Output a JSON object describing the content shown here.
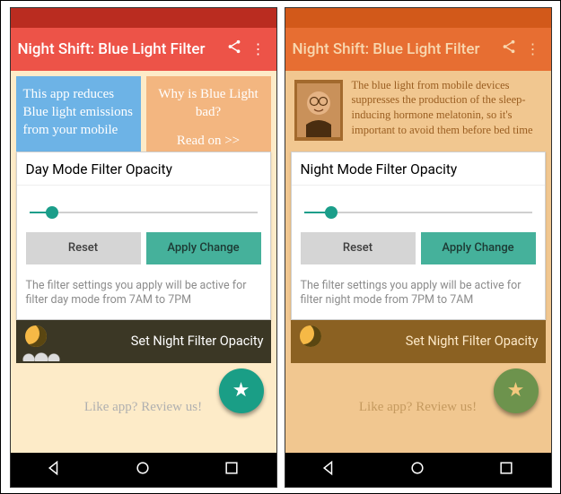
{
  "left": {
    "statusbarColor": "#ba2c20",
    "appbarColor": "#ed5348",
    "title": "Night Shift: Blue Light Filter",
    "cardBlue": "This app reduces Blue light emissions from your mobile",
    "cardOrangeLine1": "Why is Blue Light bad?",
    "cardOrangeLine2": "Read on >>",
    "panelTitle": "Day Mode Filter Opacity",
    "sliderPercent": 10,
    "resetLabel": "Reset",
    "applyLabel": "Apply Change",
    "note": "The filter settings you apply will be active for filter day mode from 7AM to 7PM",
    "nightStripLabel": "Set Night Filter Opacity",
    "reviewLabel": "Like app? Review us!"
  },
  "right": {
    "statusbarColor": "#d2591a",
    "appbarColor": "#e76e32",
    "title": "Night Shift: Blue Light Filter",
    "infoText": "The blue light from mobile devices suppresses the production of the sleep-inducing hormone melatonin, so it's important to avoid them before bed time",
    "panelTitle": "Night Mode Filter Opacity",
    "sliderPercent": 12,
    "resetLabel": "Reset",
    "applyLabel": "Apply Change",
    "note": "The filter settings you apply will be active for filter night mode from 7PM to 7AM",
    "nightStripLabel": "Set Night Filter Opacity",
    "reviewLabel": "Like app? Review us!"
  }
}
